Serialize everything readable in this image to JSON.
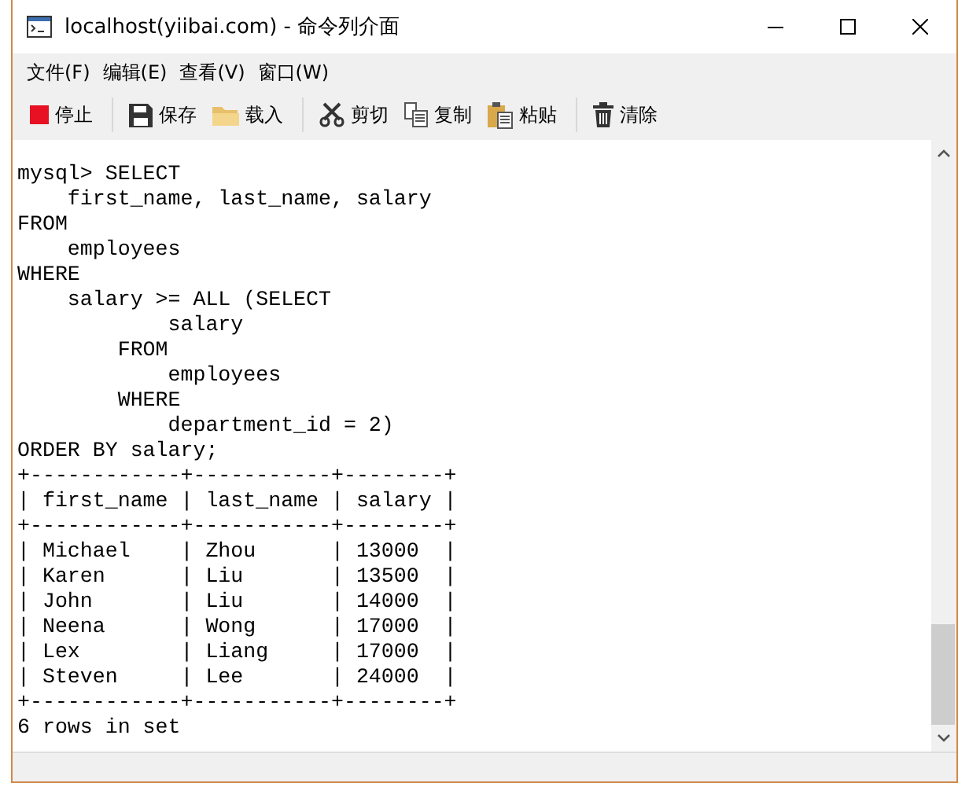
{
  "window": {
    "title": "localhost(yiibai.com) - 命令列介面"
  },
  "menu": [
    "文件(F)",
    "编辑(E)",
    "查看(V)",
    "窗口(W)"
  ],
  "toolbar": [
    [
      {
        "label": "停止",
        "kind": "stop"
      }
    ],
    [
      {
        "label": "保存",
        "kind": "save"
      },
      {
        "label": "载入",
        "kind": "load"
      }
    ],
    [
      {
        "label": "剪切",
        "kind": "cut"
      },
      {
        "label": "复制",
        "kind": "copy"
      },
      {
        "label": "粘贴",
        "kind": "paste"
      }
    ],
    [
      {
        "label": "清除",
        "kind": "clear"
      }
    ]
  ],
  "console": {
    "lines": [
      "mysql> SELECT",
      "    first_name, last_name, salary",
      "FROM",
      "    employees",
      "WHERE",
      "    salary >= ALL (SELECT",
      "            salary",
      "        FROM",
      "            employees",
      "        WHERE",
      "            department_id = 2)",
      "ORDER BY salary;",
      "+------------+-----------+--------+",
      "| first_name | last_name | salary |",
      "+------------+-----------+--------+",
      "| Michael    | Zhou      | 13000  |",
      "| Karen      | Liu       | 13500  |",
      "| John       | Liu       | 14000  |",
      "| Neena      | Wong      | 17000  |",
      "| Lex        | Liang     | 17000  |",
      "| Steven     | Lee       | 24000  |",
      "+------------+-----------+--------+",
      "6 rows in set"
    ]
  }
}
